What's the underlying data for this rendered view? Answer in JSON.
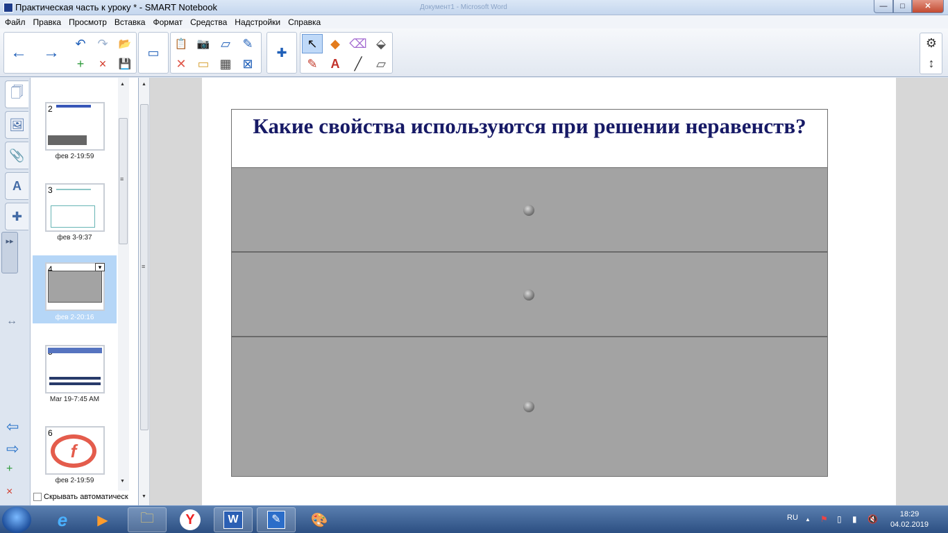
{
  "window": {
    "title": "Практическая часть к уроку * - SMART Notebook",
    "background_window": "Документ1 - Microsoft Word",
    "controls": {
      "minimize": "—",
      "maximize": "□",
      "close": "✕"
    }
  },
  "menu": [
    "Файл",
    "Правка",
    "Просмотр",
    "Вставка",
    "Формат",
    "Средства",
    "Надстройки",
    "Справка"
  ],
  "toolbar": {
    "icons": {
      "back": "←",
      "forward": "→",
      "undo": "↶",
      "redo": "↷",
      "add_page": "+",
      "delete_page": "×",
      "open": "📂",
      "save": "💾",
      "screen_shade": "▭",
      "paste": "📋",
      "capture": "📷",
      "scanner": "▱",
      "recognize": "✎",
      "delete": "✕",
      "screen": "▭",
      "table": "▦",
      "clear": "⊠",
      "addon": "✚",
      "select": "↖",
      "shapes": "◆",
      "eraser": "⌫",
      "fill": "⬙",
      "pens": "✎",
      "text": "A",
      "line": "╱",
      "magic_pen": "▱"
    },
    "side": {
      "settings": "⚙",
      "move": "↕"
    }
  },
  "side_panel": {
    "tabs": [
      "page-sorter",
      "gallery",
      "attachments",
      "properties",
      "addons"
    ],
    "tab_icons": [
      "🗍",
      "🖼",
      "📎",
      "A",
      "✚"
    ],
    "handle": "▸▸",
    "resize": "↔",
    "nav": {
      "prev": "⇦",
      "next": "⇨"
    },
    "thumbnails": [
      {
        "num": "2",
        "caption": "фев 2-19:59"
      },
      {
        "num": "3",
        "caption": "фев 3-9:37"
      },
      {
        "num": "4",
        "caption": "фев 2-20:16"
      },
      {
        "num": "5",
        "caption": "Mar 19-7:45 AM"
      },
      {
        "num": "6",
        "caption": "фев 2-19:59"
      }
    ],
    "autohide_label": "Скрывать автоматическ",
    "scroll": {
      "up": "▲",
      "down": "▼",
      "grip": "≡"
    },
    "thumb_menu": "▾",
    "slide6_logo": "f"
  },
  "canvas": {
    "title": "Какие свойства используются при решении неравенств?",
    "rows": 3
  },
  "taskbar": {
    "apps": [
      "internet-explorer",
      "media-player",
      "file-explorer",
      "yandex-browser",
      "microsoft-word",
      "smart-notebook",
      "paint"
    ],
    "app_icons": [
      "e",
      "▶",
      "🗀",
      "Y",
      "W",
      "✎",
      "🎨"
    ],
    "tray": {
      "language": "RU",
      "time": "18:29",
      "date": "04.02.2019",
      "show_hidden": "▲",
      "network": "▮",
      "battery": "▯",
      "volume": "🔇",
      "flag": "⚑"
    }
  }
}
